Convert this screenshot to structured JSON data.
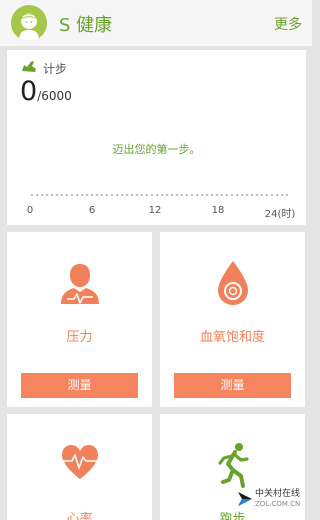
{
  "header": {
    "title": "S 健康",
    "more_label": "更多"
  },
  "steps": {
    "label": "计步",
    "count": "0",
    "goal": "/6000",
    "message": "迈出您的第一步。",
    "timeline_ticks": [
      "0",
      "6",
      "12",
      "18",
      "24(时)"
    ]
  },
  "tiles": {
    "stress": {
      "label": "压力",
      "button": "测量"
    },
    "spo2": {
      "label": "血氧饱和度",
      "button": "测量"
    },
    "heart_rate": {
      "label": "心率"
    },
    "running": {
      "label": "跑步"
    }
  },
  "watermark": {
    "name": "中关村在线",
    "url": "ZOL.COM.CN"
  },
  "colors": {
    "brand_green": "#6aa22e",
    "accent_orange": "#f6855f",
    "icon_orange": "#f0815a"
  }
}
